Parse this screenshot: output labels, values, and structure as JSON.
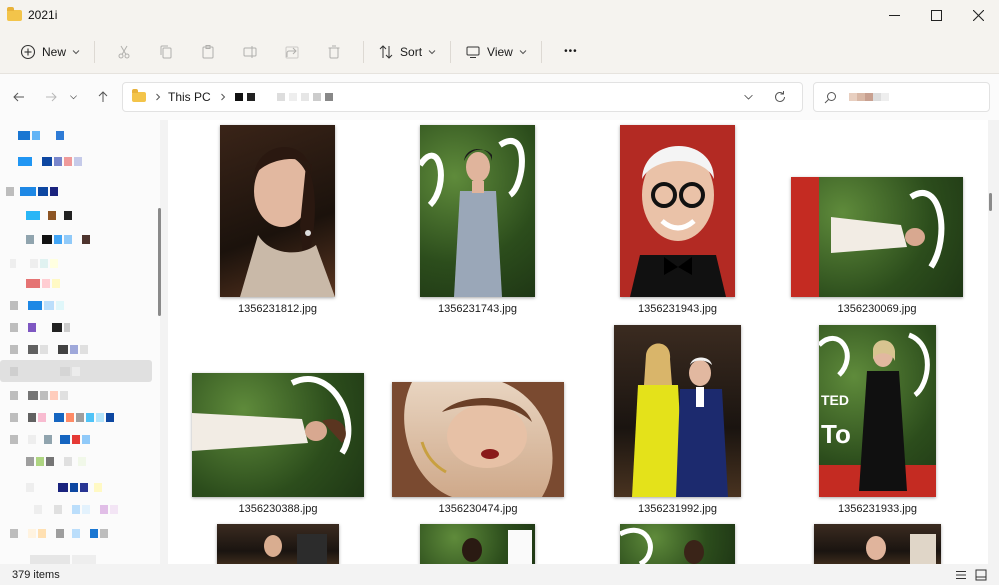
{
  "window": {
    "title": "2021i",
    "controls": {
      "minimize": "—",
      "maximize": "☐",
      "close": "✕"
    }
  },
  "command_bar": {
    "new_label": "New",
    "sort_label": "Sort",
    "view_label": "View",
    "more_label": "•••"
  },
  "address_bar": {
    "crumb_this_pc": "This PC"
  },
  "files": [
    {
      "name": "1356231812.jpg"
    },
    {
      "name": "1356231743.jpg"
    },
    {
      "name": "1356231943.jpg"
    },
    {
      "name": "1356230069.jpg"
    },
    {
      "name": "1356230388.jpg"
    },
    {
      "name": "1356230474.jpg"
    },
    {
      "name": "1356231992.jpg"
    },
    {
      "name": "1356231933.jpg"
    }
  ],
  "status": {
    "item_count": "379 items"
  },
  "colors": {
    "folder": "#f3c44a",
    "window_bg": "#f5f3ef",
    "content_bg": "#ffffff",
    "selection": "#e0e0e0"
  }
}
